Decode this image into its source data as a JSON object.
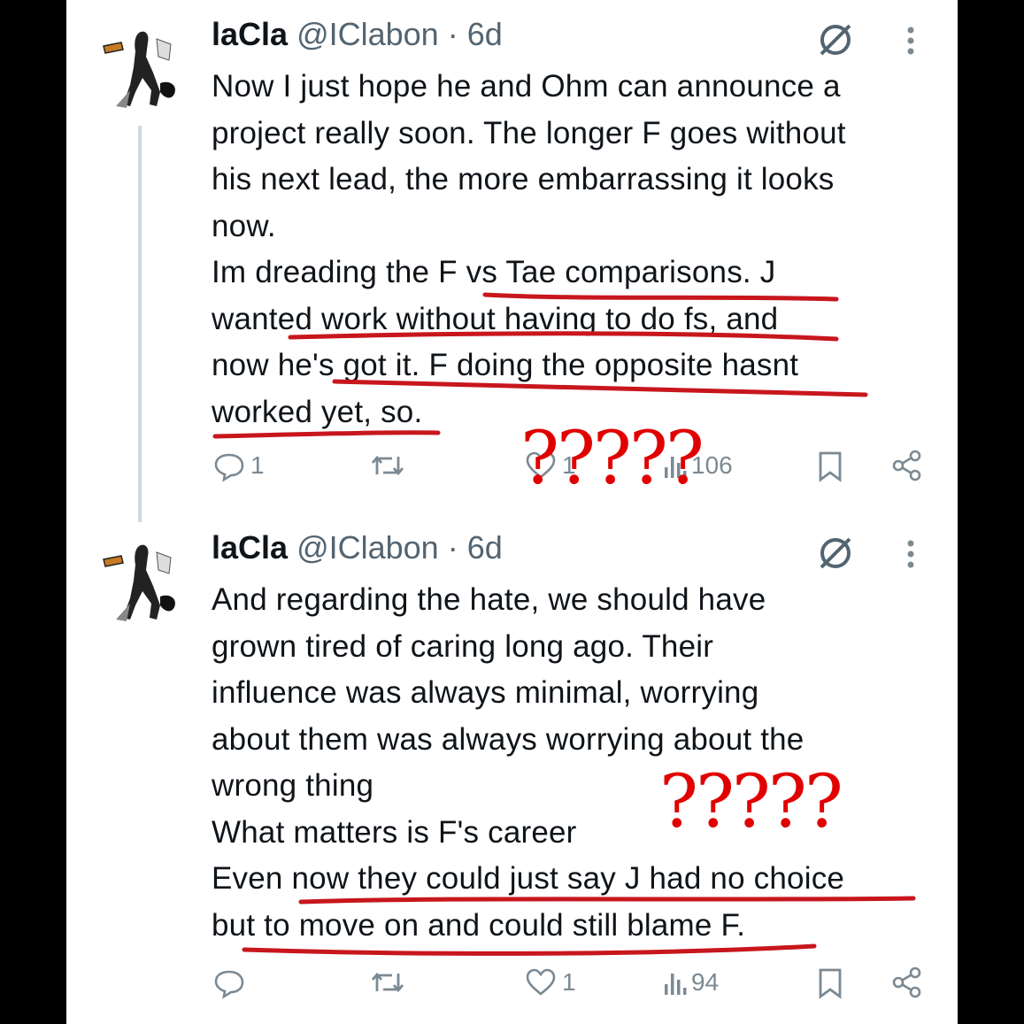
{
  "tweets": [
    {
      "display_name": "laCla",
      "handle": "@IClabon",
      "separator": "·",
      "time": "6d",
      "lines": [
        "Now I just hope he and Ohm can announce a",
        "project really soon. The longer F goes without",
        "his next lead, the more embarrassing it looks",
        "now.",
        "Im dreading the F vs Tae comparisons. J",
        "wanted work without having to do fs, and",
        "now he's got it. F doing the opposite hasnt",
        "worked yet, so."
      ],
      "replies": "1",
      "reposts": "",
      "likes": "1",
      "views": "106"
    },
    {
      "display_name": "laCla",
      "handle": "@IClabon",
      "separator": "·",
      "time": "6d",
      "lines": [
        "And regarding the hate, we should have",
        "grown tired of caring long ago. Their",
        "influence was always minimal, worrying",
        "about them was always worrying about the",
        "wrong thing",
        "What matters is F's career",
        "Even now they could just say J had no choice",
        "but to move on and could still blame F."
      ],
      "replies": "",
      "reposts": "",
      "likes": "1",
      "views": "94"
    }
  ],
  "annotations": {
    "question_marks_1": "?????",
    "question_marks_2": "?????",
    "ink_color": "#e00000"
  },
  "icons": [
    "grok-icon",
    "more-vertical-icon",
    "reply-icon",
    "repost-icon",
    "like-icon",
    "views-icon",
    "bookmark-icon",
    "share-icon"
  ]
}
